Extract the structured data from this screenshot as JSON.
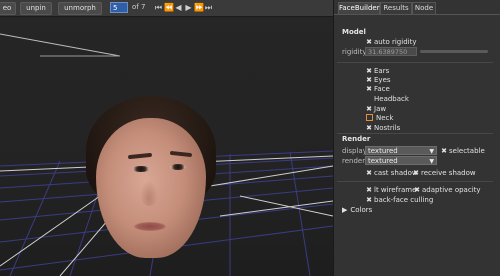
{
  "toolbar": {
    "btn_video": "eo",
    "btn_unpin": "unpin",
    "btn_unmorph": "unmorph",
    "frame": "5",
    "frame_of": "of",
    "frame_total": "7"
  },
  "panel": {
    "tabs": [
      "FaceBuilder",
      "Results",
      "Node"
    ],
    "model": {
      "title": "Model",
      "auto_rigidity": "auto rigidity",
      "rigidity_label": "rigidity",
      "rigidity_value": "31.6389750"
    },
    "parts": [
      {
        "label": "Ears",
        "checked": true
      },
      {
        "label": "Eyes",
        "checked": true
      },
      {
        "label": "Face",
        "checked": true
      },
      {
        "label": "Headback",
        "checked": false
      },
      {
        "label": "Jaw",
        "checked": true
      },
      {
        "label": "Neck",
        "checked": false
      },
      {
        "label": "Nostrils",
        "checked": true
      }
    ],
    "render": {
      "title": "Render",
      "display_label": "display",
      "display_value": "textured",
      "selectable": "selectable",
      "render_label": "render",
      "render_value": "textured",
      "cast_shadow": "cast shadow",
      "receive_shadow": "receive shadow",
      "lt_wireframe": "lt wireframe",
      "adaptive_opacity": "adaptive opacity",
      "backface_culling": "back-face culling"
    },
    "colors": "Colors"
  },
  "colors": {
    "accent": "#2f5fa8",
    "checkbox_orange": "#e0903c",
    "panel_bg": "#333333"
  }
}
